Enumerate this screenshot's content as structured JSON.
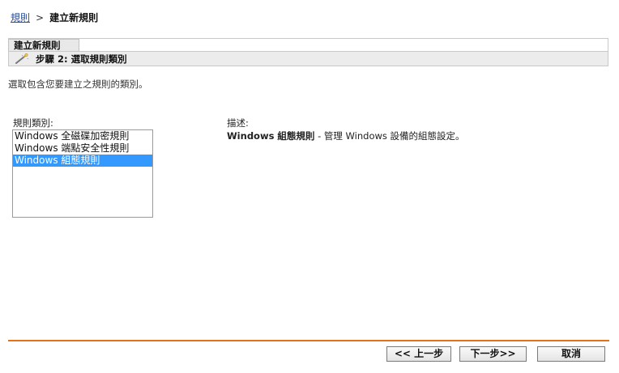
{
  "breadcrumb": {
    "link": "規則",
    "separator": ">",
    "current": "建立新規則"
  },
  "panel": {
    "tab_label": "建立新規則",
    "step_label": "步驟 2:  選取規則類別",
    "step_icon": "wand-icon"
  },
  "instruction": "選取包含您要建立之規則的類別。",
  "category": {
    "label": "規則類別:",
    "items": [
      "Windows 全磁碟加密規則",
      "Windows 端點安全性規則",
      "Windows 組態規則"
    ],
    "selected_index": 2
  },
  "description": {
    "label": "描述:",
    "title": "Windows 組態規則",
    "text": " - 管理 Windows 設備的組態設定。"
  },
  "buttons": {
    "prev": "<< 上一步",
    "next": "下一步>>",
    "cancel": "取消"
  },
  "colors": {
    "accent_line": "#e2731c",
    "selection": "#3399ff",
    "link": "#2a4e9c"
  }
}
